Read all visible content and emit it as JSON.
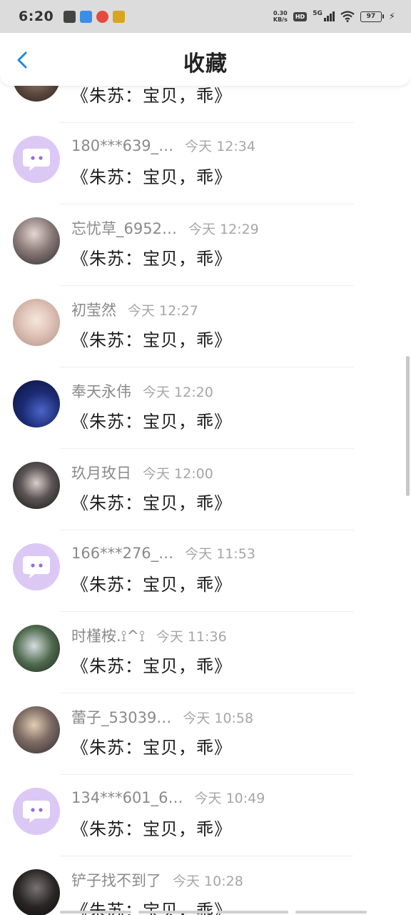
{
  "status_bar": {
    "time": "6:20",
    "net_speed_value": "0.30",
    "net_speed_unit": "KB/s",
    "hd": "HD",
    "signal": "5G",
    "battery": "97"
  },
  "header": {
    "title": "收藏"
  },
  "items": [
    {
      "name": "",
      "time": "",
      "message": "《朱苏：宝贝，乖》",
      "avatar": "photo-dark"
    },
    {
      "name": "180***639_…",
      "time": "今天 12:34",
      "message": "《朱苏：宝贝，乖》",
      "avatar": "default"
    },
    {
      "name": "忘忧草_6952…",
      "time": "今天 12:29",
      "message": "《朱苏：宝贝，乖》",
      "avatar": "photo-gray"
    },
    {
      "name": "初莹然",
      "time": "今天 12:27",
      "message": "《朱苏：宝贝，乖》",
      "avatar": "photo-floral"
    },
    {
      "name": "奉天永伟",
      "time": "今天 12:20",
      "message": "《朱苏：宝贝，乖》",
      "avatar": "photo-night"
    },
    {
      "name": "玖月玫日",
      "time": "今天 12:00",
      "message": "《朱苏：宝贝，乖》",
      "avatar": "photo-girl-dark"
    },
    {
      "name": "166***276_…",
      "time": "今天 11:53",
      "message": "《朱苏：宝贝，乖》",
      "avatar": "default"
    },
    {
      "name": "时槿桉.⟟^⟟",
      "time": "今天 11:36",
      "message": "《朱苏：宝贝，乖》",
      "avatar": "photo-glasses"
    },
    {
      "name": "蕾子_53039…",
      "time": "今天 10:58",
      "message": "《朱苏：宝贝，乖》",
      "avatar": "photo-art"
    },
    {
      "name": "134***601_6…",
      "time": "今天 10:49",
      "message": "《朱苏：宝贝，乖》",
      "avatar": "default"
    },
    {
      "name": "铲子找不到了",
      "time": "今天 10:28",
      "message": "《朱苏：宝贝，乖》",
      "avatar": "photo-black"
    }
  ],
  "colors": {
    "accent": "#1E88E5",
    "default_avatar_bg": "#DCC8F5",
    "default_avatar_bubble": "#FFFFFF",
    "default_avatar_dot": "#9B6BE0"
  }
}
